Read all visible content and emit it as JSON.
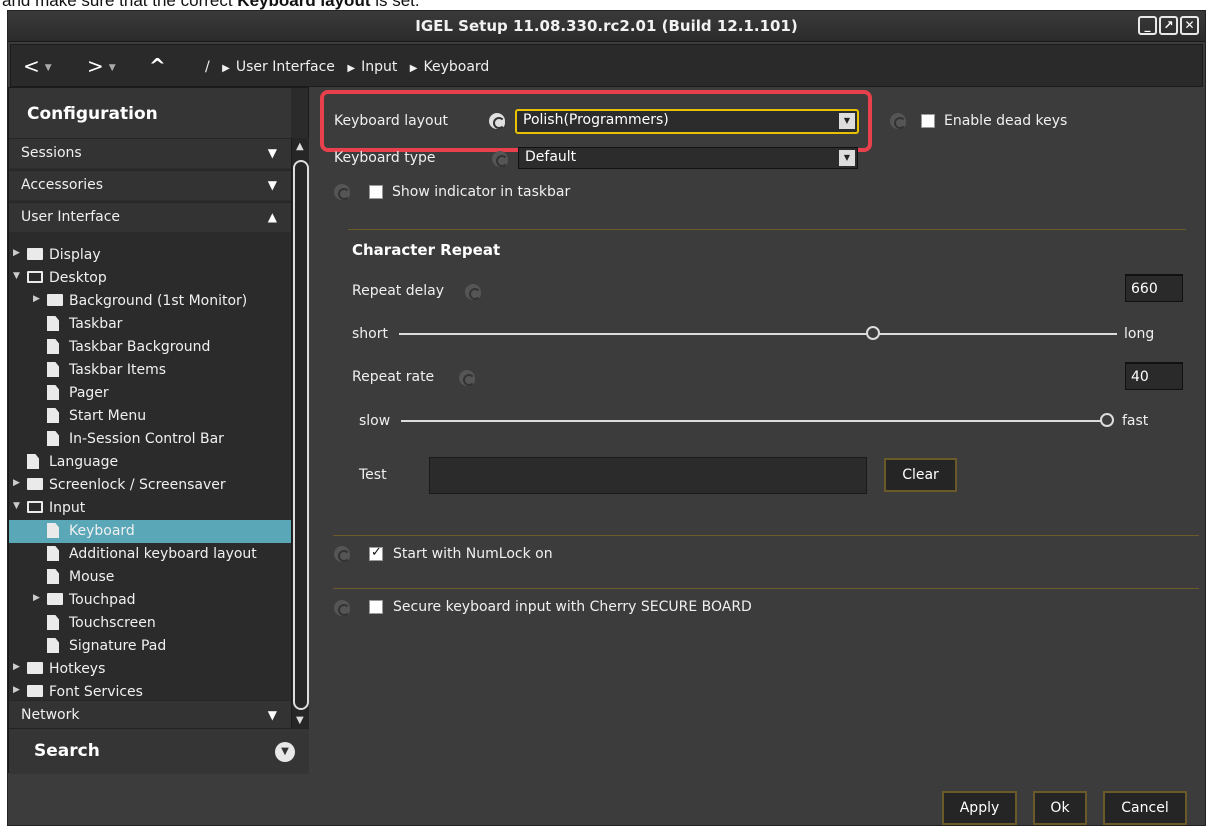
{
  "caption": {
    "prefix": "and make sure that the correct ",
    "bold": "Keyboard layout",
    "suffix": " is set."
  },
  "window": {
    "title": "IGEL Setup 11.08.330.rc2.01 (Build 12.1.101)",
    "min": "_",
    "max": "↗",
    "close": "✕"
  },
  "nav": {
    "back": "<",
    "forward": ">",
    "up": "^",
    "breadcrumb": {
      "root": "/",
      "items": [
        "User Interface",
        "Input",
        "Keyboard"
      ]
    }
  },
  "sidebar": {
    "header": "Configuration",
    "categories": [
      {
        "label": "Sessions",
        "arrow": "▼"
      },
      {
        "label": "Accessories",
        "arrow": "▼"
      },
      {
        "label": "User Interface",
        "arrow": "▲"
      }
    ],
    "tree": [
      {
        "label": "Display",
        "level": 0,
        "type": "folder",
        "twisty": "▶"
      },
      {
        "label": "Desktop",
        "level": 0,
        "type": "folder-open",
        "twisty": "▼"
      },
      {
        "label": "Background (1st Monitor)",
        "level": 1,
        "type": "folder",
        "twisty": "▶"
      },
      {
        "label": "Taskbar",
        "level": 1,
        "type": "doc"
      },
      {
        "label": "Taskbar Background",
        "level": 1,
        "type": "doc"
      },
      {
        "label": "Taskbar Items",
        "level": 1,
        "type": "doc"
      },
      {
        "label": "Pager",
        "level": 1,
        "type": "doc"
      },
      {
        "label": "Start Menu",
        "level": 1,
        "type": "doc"
      },
      {
        "label": "In-Session Control Bar",
        "level": 1,
        "type": "doc"
      },
      {
        "label": "Language",
        "level": 0,
        "type": "doc"
      },
      {
        "label": "Screenlock / Screensaver",
        "level": 0,
        "type": "folder",
        "twisty": "▶"
      },
      {
        "label": "Input",
        "level": 0,
        "type": "folder-open",
        "twisty": "▼"
      },
      {
        "label": "Keyboard",
        "level": 1,
        "type": "doc",
        "selected": true
      },
      {
        "label": "Additional keyboard layout",
        "level": 1,
        "type": "doc"
      },
      {
        "label": "Mouse",
        "level": 1,
        "type": "doc"
      },
      {
        "label": "Touchpad",
        "level": 1,
        "type": "folder",
        "twisty": "▶"
      },
      {
        "label": "Touchscreen",
        "level": 1,
        "type": "doc"
      },
      {
        "label": "Signature Pad",
        "level": 1,
        "type": "doc"
      },
      {
        "label": "Hotkeys",
        "level": 0,
        "type": "folder",
        "twisty": "▶"
      },
      {
        "label": "Font Services",
        "level": 0,
        "type": "folder",
        "twisty": "▶"
      }
    ],
    "network": {
      "label": "Network",
      "arrow": "▼"
    },
    "search": {
      "label": "Search",
      "icon": "▼"
    }
  },
  "main": {
    "keyboard_layout": {
      "label": "Keyboard layout",
      "value": "Polish(Programmers)"
    },
    "dead_keys": {
      "label": "Enable dead keys",
      "checked": false
    },
    "keyboard_type": {
      "label": "Keyboard type",
      "value": "Default"
    },
    "show_indicator": {
      "label": "Show indicator in taskbar",
      "checked": false
    },
    "char_repeat": {
      "title": "Character Repeat",
      "repeat_delay": {
        "label": "Repeat delay",
        "value": "660",
        "min_label": "short",
        "max_label": "long",
        "fraction": 0.66
      },
      "repeat_rate": {
        "label": "Repeat rate",
        "value": "40",
        "min_label": "slow",
        "max_label": "fast",
        "fraction": 1.0
      },
      "test": {
        "label": "Test",
        "value": ""
      },
      "clear": "Clear"
    },
    "numlock": {
      "label": "Start with NumLock on",
      "checked": true
    },
    "cherry": {
      "label": "Secure keyboard input with Cherry SECURE BOARD",
      "checked": false
    }
  },
  "footer": {
    "apply": "Apply",
    "ok": "Ok",
    "cancel": "Cancel"
  },
  "colors": {
    "highlight": "#e8404c",
    "selection": "#5aa7b8",
    "focus": "#e6c200"
  }
}
